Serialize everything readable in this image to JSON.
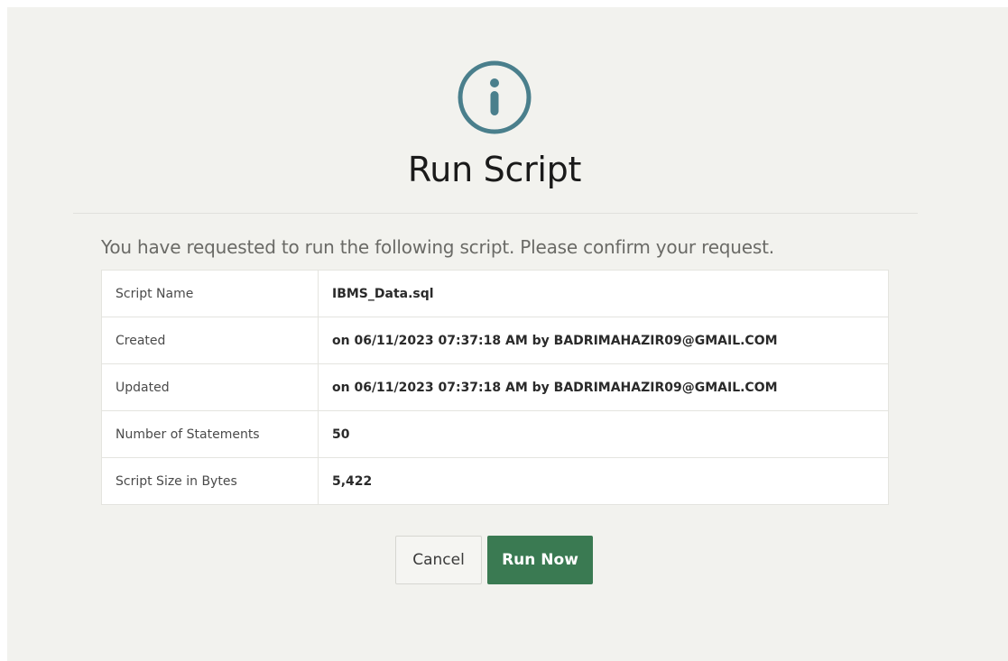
{
  "dialog": {
    "icon": "info-circle-icon",
    "title": "Run Script",
    "intro": "You have requested to run the following script. Please confirm your request.",
    "accent_color": "#4a7f8c"
  },
  "details": {
    "rows": [
      {
        "label": "Script Name",
        "value": "IBMS_Data.sql"
      },
      {
        "label": "Created",
        "value": "on 06/11/2023 07:37:18 AM by BADRIMAHAZIR09@GMAIL.COM"
      },
      {
        "label": "Updated",
        "value": "on 06/11/2023 07:37:18 AM by BADRIMAHAZIR09@GMAIL.COM"
      },
      {
        "label": "Number of Statements",
        "value": "50"
      },
      {
        "label": "Script Size in Bytes",
        "value": "5,422"
      }
    ]
  },
  "buttons": {
    "cancel_label": "Cancel",
    "run_label": "Run Now",
    "run_color": "#3a7a52"
  }
}
